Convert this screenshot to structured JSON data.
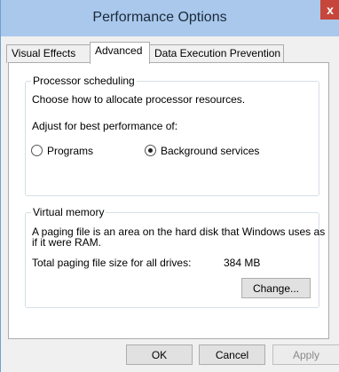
{
  "window": {
    "title": "Performance Options",
    "close_glyph": "x"
  },
  "tabs": [
    {
      "label": "Visual Effects",
      "active": false
    },
    {
      "label": "Advanced",
      "active": true
    },
    {
      "label": "Data Execution Prevention",
      "active": false
    }
  ],
  "processor": {
    "legend": "Processor scheduling",
    "description": "Choose how to allocate processor resources.",
    "adjust_label": "Adjust for best performance of:",
    "options": [
      {
        "label": "Programs",
        "selected": false
      },
      {
        "label": "Background services",
        "selected": true
      }
    ]
  },
  "virtual_memory": {
    "legend": "Virtual memory",
    "description_line1": "A paging file is an area on the hard disk that Windows uses as",
    "description_line2": "if it were RAM.",
    "total_label": "Total paging file size for all drives:",
    "total_value": "384 MB",
    "change_label": "Change..."
  },
  "footer": {
    "ok_label": "OK",
    "cancel_label": "Cancel",
    "apply_label": "Apply"
  }
}
